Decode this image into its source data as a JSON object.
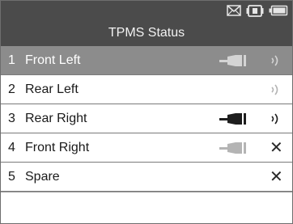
{
  "header": {
    "title": "TPMS Status",
    "status_icons": [
      "envelope-icon",
      "vehicle-connector-icon",
      "battery-icon"
    ]
  },
  "sensors": [
    {
      "index": "1",
      "name": "Front Left",
      "selected": true,
      "sensor_icon": "sensor-dim",
      "status": "signal-dim"
    },
    {
      "index": "2",
      "name": "Rear Left",
      "selected": false,
      "sensor_icon": "none",
      "status": "signal-dim"
    },
    {
      "index": "3",
      "name": "Rear Right",
      "selected": false,
      "sensor_icon": "sensor-dark",
      "status": "signal-dark"
    },
    {
      "index": "4",
      "name": "Front Right",
      "selected": false,
      "sensor_icon": "sensor-light",
      "status": "x"
    },
    {
      "index": "5",
      "name": "Spare",
      "selected": false,
      "sensor_icon": "none",
      "status": "x"
    }
  ],
  "status_glyphs": {
    "x": "✕"
  },
  "colors": {
    "header_bg": "#4b4b4b",
    "selected_row_bg": "#8c8c8c",
    "sensor_dark": "#1e1e1e",
    "sensor_light": "#b4b4b4",
    "sensor_on_selected": "#d4d4d4"
  }
}
